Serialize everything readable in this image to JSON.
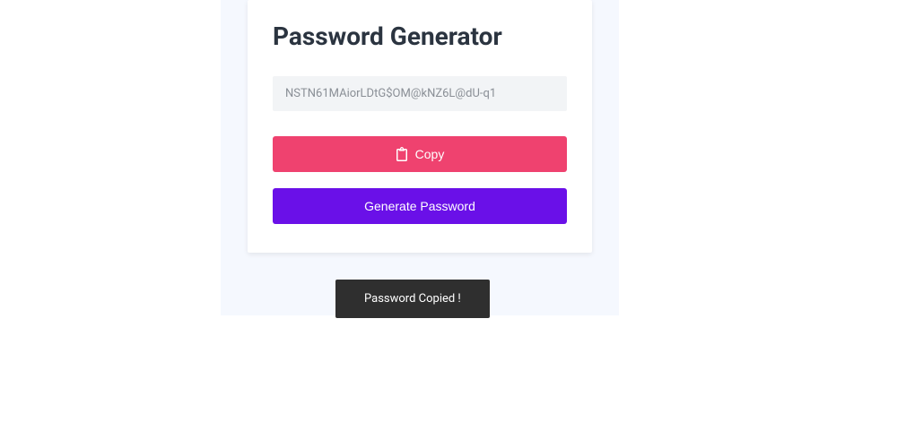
{
  "card": {
    "title": "Password Generator",
    "password_value": "NSTN61MAiorLDtG$OM@kNZ6L@dU-q1",
    "copy_label": "Copy",
    "generate_label": "Generate Password"
  },
  "toast": {
    "message": "Password Copied !"
  },
  "colors": {
    "copy_button": "#ef426f",
    "generate_button": "#6a10e8",
    "toast_bg": "#2f2f2f"
  }
}
